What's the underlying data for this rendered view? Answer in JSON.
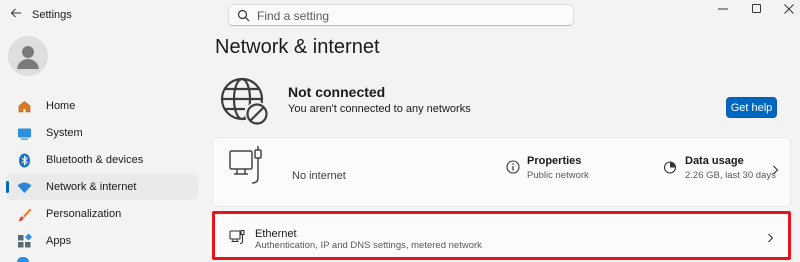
{
  "app": {
    "title": "Settings"
  },
  "search": {
    "placeholder": "Find a setting"
  },
  "sidebar": {
    "items": [
      {
        "label": "Home",
        "icon": "home-icon"
      },
      {
        "label": "System",
        "icon": "system-icon"
      },
      {
        "label": "Bluetooth & devices",
        "icon": "bluetooth-icon"
      },
      {
        "label": "Network & internet",
        "icon": "wifi-icon",
        "active": true
      },
      {
        "label": "Personalization",
        "icon": "brush-icon"
      },
      {
        "label": "Apps",
        "icon": "apps-icon"
      }
    ]
  },
  "main": {
    "page_title": "Network & internet",
    "status": {
      "title": "Not connected",
      "subtitle": "You aren't connected to any networks",
      "help_label": "Get help"
    },
    "overview": {
      "connection_text": "No internet",
      "properties": {
        "title": "Properties",
        "subtitle": "Public network"
      },
      "data_usage": {
        "title": "Data usage",
        "subtitle": "2.26 GB, last 30 days"
      }
    },
    "ethernet": {
      "title": "Ethernet",
      "subtitle": "Authentication, IP and DNS settings, metered network"
    }
  },
  "colors": {
    "accent": "#0067c0",
    "highlight_border": "#e3141c"
  }
}
